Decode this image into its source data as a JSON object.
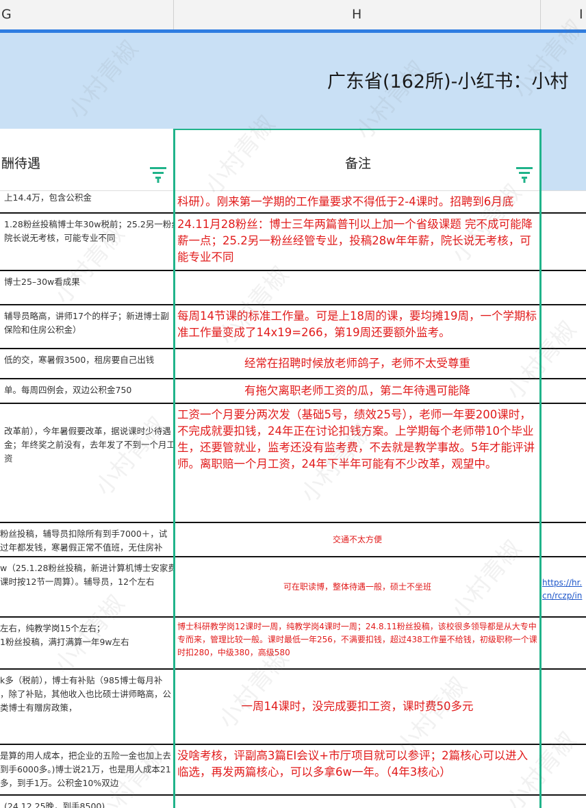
{
  "columns": {
    "g": "G",
    "h": "H",
    "i": "I"
  },
  "title": "广东省(162所)-小红书：小村",
  "headers": {
    "g": "酬待遇",
    "h": "备注"
  },
  "watermark": "小村青椒",
  "colors": {
    "accent_blue": "#2f7de1",
    "header_bg": "#c9e0f5",
    "note_red": "#e11b1b",
    "filter_green": "#20b38a",
    "link_blue": "#1c55c9"
  },
  "rows": [
    {
      "g": [
        "上14.4万，包含公积金"
      ],
      "h": "科研）。刚来第一学期的工作量要求不得低于2-4课时。招聘到6月底",
      "h_style": "big",
      "i": ""
    },
    {
      "g": [
        "1.28粉丝投稿博士年30w税前；25.2另一粉丝",
        "院长说无考核，可能专业不同"
      ],
      "h": "24.11月28粉丝：博士三年两篇普刊以上加一个省级课题 完不成可能降薪一点；25.2另一粉丝经管专业，投稿28w年年薪，院长说无考核，可能专业不同",
      "h_style": "big",
      "i": ""
    },
    {
      "g": [
        "博士25–30w看成果"
      ],
      "h": "",
      "h_style": "big",
      "i": ""
    },
    {
      "g": [
        "辅导员略高，讲师17个的样子；新进博士副",
        "保险和住房公积金）"
      ],
      "h": "每周14节课的标准工作量。可是上18周的课，要均摊19周，一个学期标准工作量变成了14x19=266，第19周还要额外监考。",
      "h_style": "big",
      "i": ""
    },
    {
      "g": [
        "低的交，寒暑假3500，租房要自己出钱"
      ],
      "h": "经常在招聘时候放老师鸽子，老师不太受尊重",
      "h_style": "big center",
      "i": ""
    },
    {
      "g": [
        "单。每周四例会，双边公积金750"
      ],
      "h": "有拖欠离职老师工资的瓜，第二年待遇可能降",
      "h_style": "big center",
      "i": ""
    },
    {
      "g": [
        "改革前），今年暑假要改革，据说课时少待遇",
        "金；年终奖之前没有，去年发了不到一个月工",
        "资"
      ],
      "h": "工资一个月要分两次发（基础5号，绩效25号），老师一年要200课时，不完成就要扣钱，24年正在讨论扣钱方案。上学期每个老师带10个毕业生，还要管就业，监考还没有监考费，不去就是教学事故。5年才能评讲师。离职赔一个月工资，24年下半年可能有不少改革，观望中。",
      "h_style": "big",
      "i": ""
    },
    {
      "g": [
        "粉丝投稿，辅导员扣除所有到手7000＋，试",
        "过年都发钱，寒暑假正常不值班，无住房补"
      ],
      "h": "交通不太方便",
      "h_style": "small center",
      "i": ""
    },
    {
      "g": [
        "w（25.1.28粉丝投稿，新进计算机博士安家费",
        "课时按12节一周算）。辅导员，12个左右"
      ],
      "h": "可在职读博，整体待遇一般，硕士不坐班",
      "h_style": "small center",
      "i": "https://hr.\ncn/rczp/in"
    },
    {
      "g": [
        "左右，纯教学岗15个左右；",
        "1粉丝投稿，满打满算一年9w左右"
      ],
      "h": "博士科研教学岗12课时一周，纯教学岗4课时一周；24.8.11粉丝投稿，该校很多领导都是从大专中专而来，管理比较一般。课时最低一年256，不满要扣钱，超过438工作量不给钱，初级职称一个课时扣280，中级380，高级580",
      "h_style": "small",
      "i": ""
    },
    {
      "g": [
        "k多（税前），博士有补贴（985博士每月补",
        "，除了补贴，其他收入也比硕士讲师略高，公",
        "类博士有赠房政策，"
      ],
      "h": "一周14课时，没完成要扣工资，课时费50多元",
      "h_style": "big center",
      "i": ""
    },
    {
      "g": [
        "是算的用人成本，把企业的五险一金也加上去",
        "到手6000多。)博士说21万，也是用人成本21",
        "多，到手1万。公积金10%双边"
      ],
      "h": "没啥考核，评副高3篇EI会议+市厅项目就可以参评；2篇核心可以进入临选，再发两篇核心，可以多拿6w一年。（4年3核心）",
      "h_style": "big",
      "i": ""
    },
    {
      "g": [
        "(24.12.25晚，到手8500)"
      ],
      "h": "",
      "h_style": "big",
      "i": ""
    }
  ]
}
